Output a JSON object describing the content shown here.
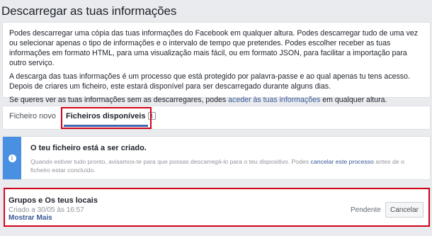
{
  "page_title": "Descarregar as tuas informações",
  "intro": {
    "p1": "Podes descarregar uma cópia das tuas informações do Facebook em qualquer altura. Podes descarregar tudo de uma vez ou selecionar apenas o tipo de informações e o intervalo de tempo que pretendes. Podes escolher receber as tuas informações em formato HTML, para uma visualização mais fácil, ou em formato JSON, para facilitar a importação para outro serviço.",
    "p2": "A descarga das tuas informações é um processo que está protegido por palavra-passe e ao qual apenas tu tens acesso. Depois de criares um ficheiro, este estará disponível para ser descarregado durante alguns dias.",
    "p3_before": "Se queres ver as tuas informações sem as descarregares, podes ",
    "p3_link": "aceder às tuas informações",
    "p3_after": " em qualquer altura."
  },
  "tabs": {
    "new_file": "Ficheiro novo",
    "available_files": "Ficheiros disponíveis",
    "available_count": "1"
  },
  "notice": {
    "icon": "info-icon",
    "title": "O teu ficheiro está a ser criado.",
    "body_before": "Quando estiver tudo pronto, avisamos-te para que possas descarregá-lo para o teu dispositivo. Podes ",
    "body_link": "cancelar este processo",
    "body_after": " antes de o ficheiro estar concluído."
  },
  "file": {
    "name": "Grupos e Os teus locais",
    "created": "Criado a 30/05 às 16:57",
    "show_more": "Mostrar Mais",
    "status": "Pendente",
    "cancel_label": "Cancelar"
  },
  "colors": {
    "accent": "#4267b2",
    "link": "#385898",
    "highlight": "#d0021b",
    "notice_strip": "#4a90e2"
  }
}
